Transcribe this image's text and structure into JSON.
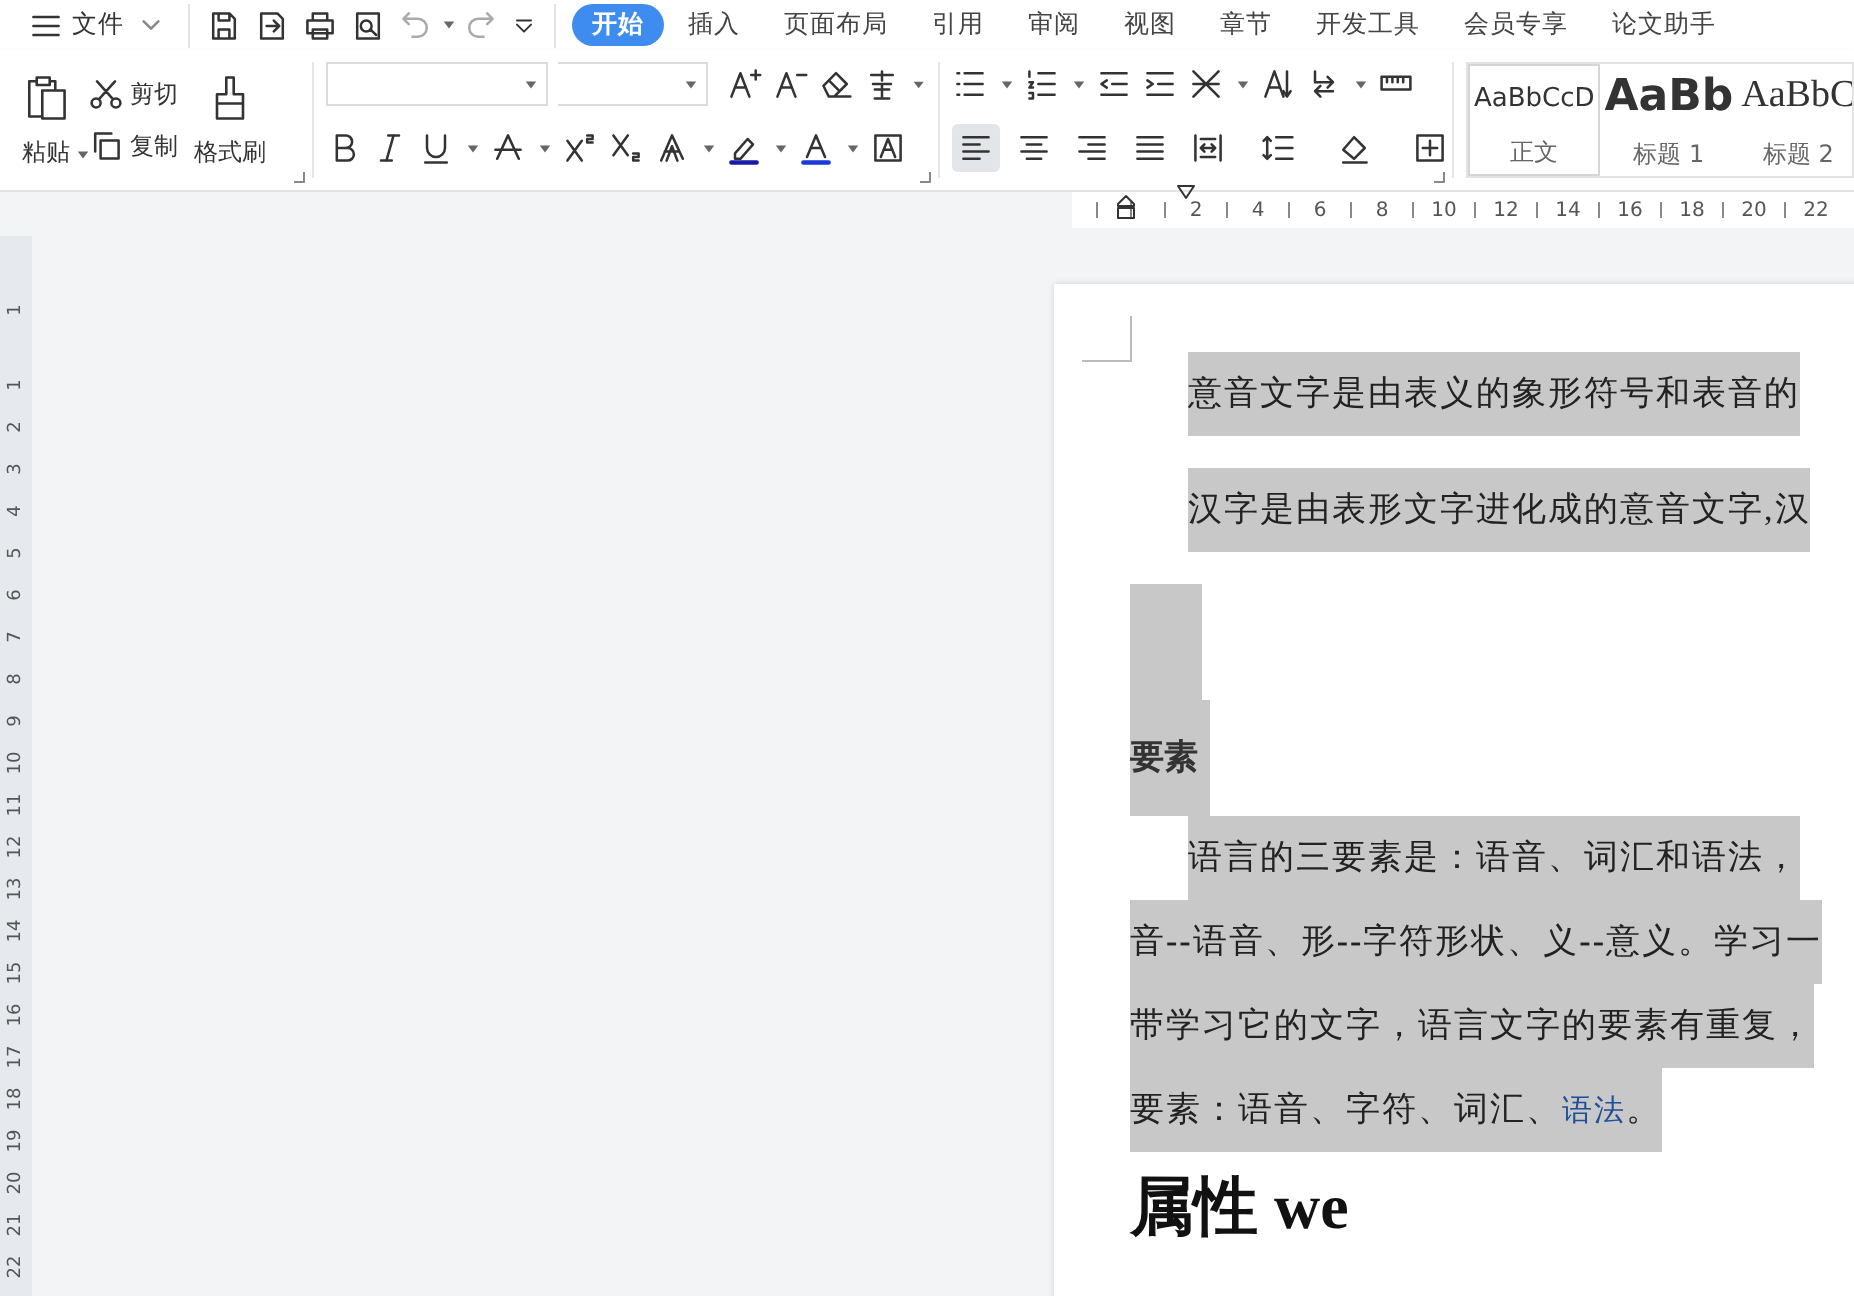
{
  "file_menu": {
    "label": "文件"
  },
  "tabs": [
    {
      "label": "开始",
      "selected": true
    },
    {
      "label": "插入",
      "selected": false
    },
    {
      "label": "页面布局",
      "selected": false
    },
    {
      "label": "引用",
      "selected": false
    },
    {
      "label": "审阅",
      "selected": false
    },
    {
      "label": "视图",
      "selected": false
    },
    {
      "label": "章节",
      "selected": false
    },
    {
      "label": "开发工具",
      "selected": false
    },
    {
      "label": "会员专享",
      "selected": false
    },
    {
      "label": "论文助手",
      "selected": false
    }
  ],
  "clipboard": {
    "paste": "粘贴",
    "cut": "剪切",
    "copy": "复制",
    "format_painter": "格式刷"
  },
  "alignment": [
    {
      "kind": "left",
      "selected": true
    },
    {
      "kind": "center",
      "selected": false
    },
    {
      "kind": "right",
      "selected": false
    },
    {
      "kind": "justify",
      "selected": false
    },
    {
      "kind": "distributed",
      "selected": false
    }
  ],
  "styles": [
    {
      "kind": "normal",
      "preview": "AaBbCcD",
      "name": "正文",
      "selected": true
    },
    {
      "kind": "heading1",
      "preview": "AaBb",
      "name": "标题 1",
      "selected": false
    },
    {
      "kind": "heading2",
      "preview": "AaBbC",
      "name": "标题 2",
      "selected": false
    }
  ],
  "ruler": {
    "marks": [
      "2",
      "4",
      "6",
      "8",
      "10",
      "12",
      "14",
      "16",
      "18",
      "20",
      "22"
    ]
  },
  "vertical_ruler": {
    "top_mark": "1",
    "marks": [
      "1",
      "2",
      "3",
      "4",
      "5",
      "6",
      "7",
      "8",
      "9",
      "10",
      "11",
      "12",
      "13",
      "14",
      "15",
      "16",
      "17",
      "18",
      "19",
      "20",
      "21",
      "22"
    ]
  },
  "document": {
    "blocks": [
      {
        "kind": "body",
        "indent": true,
        "selected": true,
        "text": "意音文字是由表义的象形符号和表音的"
      },
      {
        "kind": "body",
        "indent": true,
        "selected": true,
        "text": "汉字是由表形文字进化成的意音文字,汉"
      },
      {
        "kind": "blank",
        "selected": true
      },
      {
        "kind": "heading",
        "selected": true,
        "text": "要素"
      },
      {
        "kind": "paragraph",
        "selected": true,
        "lines": [
          "语言的三要素是：语音、词汇和语法，",
          "音**--**语音、形**--**字符形状、义**--**意义。学习一",
          "带学习它的文字，语言文字的要素有重复，"
        ],
        "last_line": {
          "before": "要素：语音、字符、词汇、",
          "link": "语法",
          "after": "。"
        }
      },
      {
        "kind": "title",
        "selected": false,
        "text": "属性 we"
      }
    ]
  }
}
